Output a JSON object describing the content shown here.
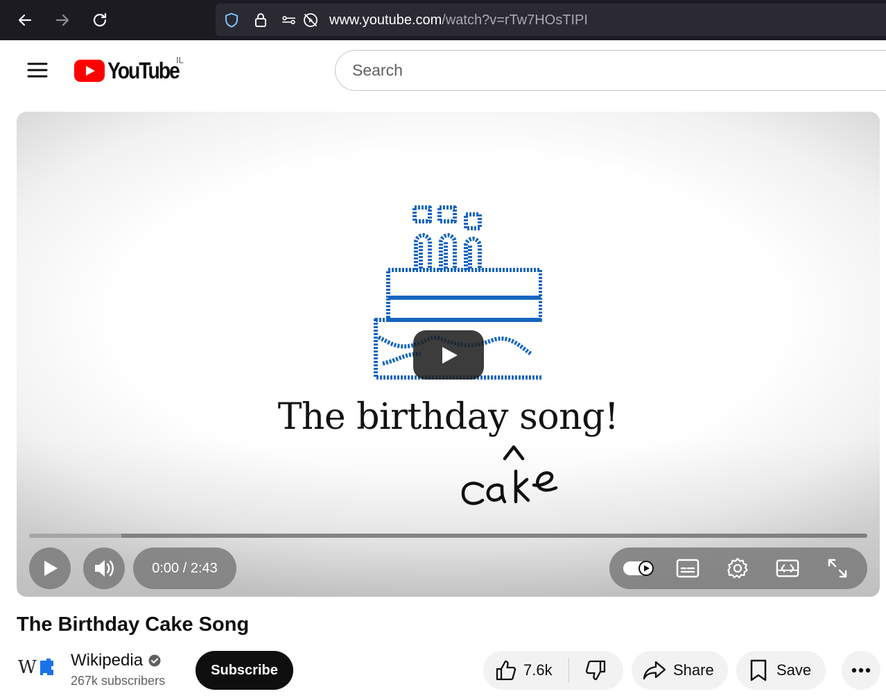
{
  "browser": {
    "url_host": "www.youtube.com",
    "url_path": "/watch?v=rTw7HOsTIPI"
  },
  "header": {
    "logo_text": "YouTube",
    "country_code": "IL",
    "search_placeholder": "Search"
  },
  "player": {
    "video_text": "The birthday song!",
    "inserted_word": "cake",
    "current_time": "0:00",
    "duration": "2:43",
    "time_display": "0:00 / 2:43",
    "buffered_fraction": 0.11
  },
  "video": {
    "title": "The Birthday Cake Song",
    "channel": "Wikipedia",
    "subscribers": "267k subscribers",
    "subscribe_label": "Subscribe",
    "likes": "7.6k",
    "share_label": "Share",
    "save_label": "Save"
  },
  "colors": {
    "youtube_red": "#ff0000",
    "cake_blue": "#1565c0",
    "browser_bg": "#1c1b22"
  }
}
